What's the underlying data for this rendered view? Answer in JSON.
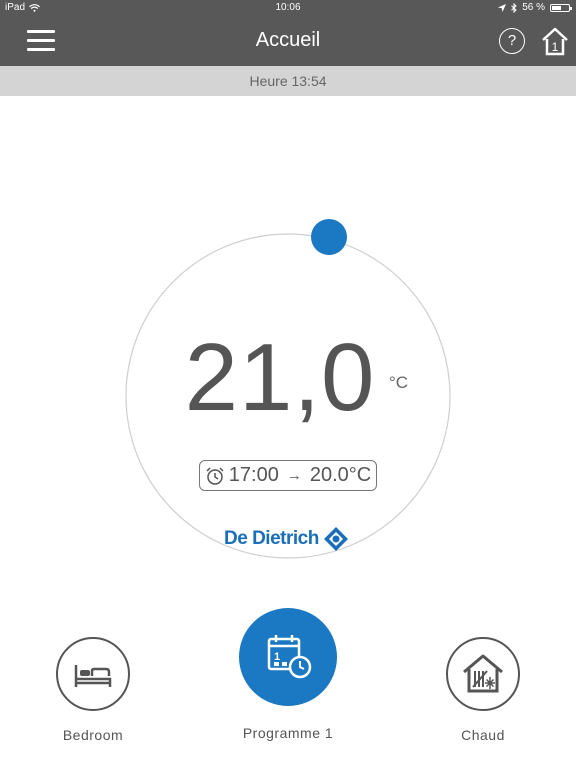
{
  "status_bar": {
    "device": "iPad",
    "time": "10:06",
    "battery": "56 %",
    "battery_level": 0.56
  },
  "nav": {
    "title": "Accueil",
    "help": "?",
    "home_badge": "1"
  },
  "time_bar": {
    "label": "Heure 13:54"
  },
  "dial": {
    "temperature": "21,0",
    "unit": "°C",
    "schedule_time": "17:00",
    "schedule_arrow": "→",
    "schedule_temp": "20.0°C",
    "setpoint_fraction": 0.0,
    "brand": "De Dietrich"
  },
  "modes": [
    {
      "label": "Bedroom",
      "icon": "bed-icon",
      "active": false
    },
    {
      "label": "Programme 1",
      "icon": "calendar-clock-icon",
      "active": true
    },
    {
      "label": "Chaud",
      "icon": "house-heat-icon",
      "active": false
    }
  ],
  "colors": {
    "accent": "#1b78c2",
    "navbar": "#585858",
    "timebar": "#d4d4d4"
  }
}
